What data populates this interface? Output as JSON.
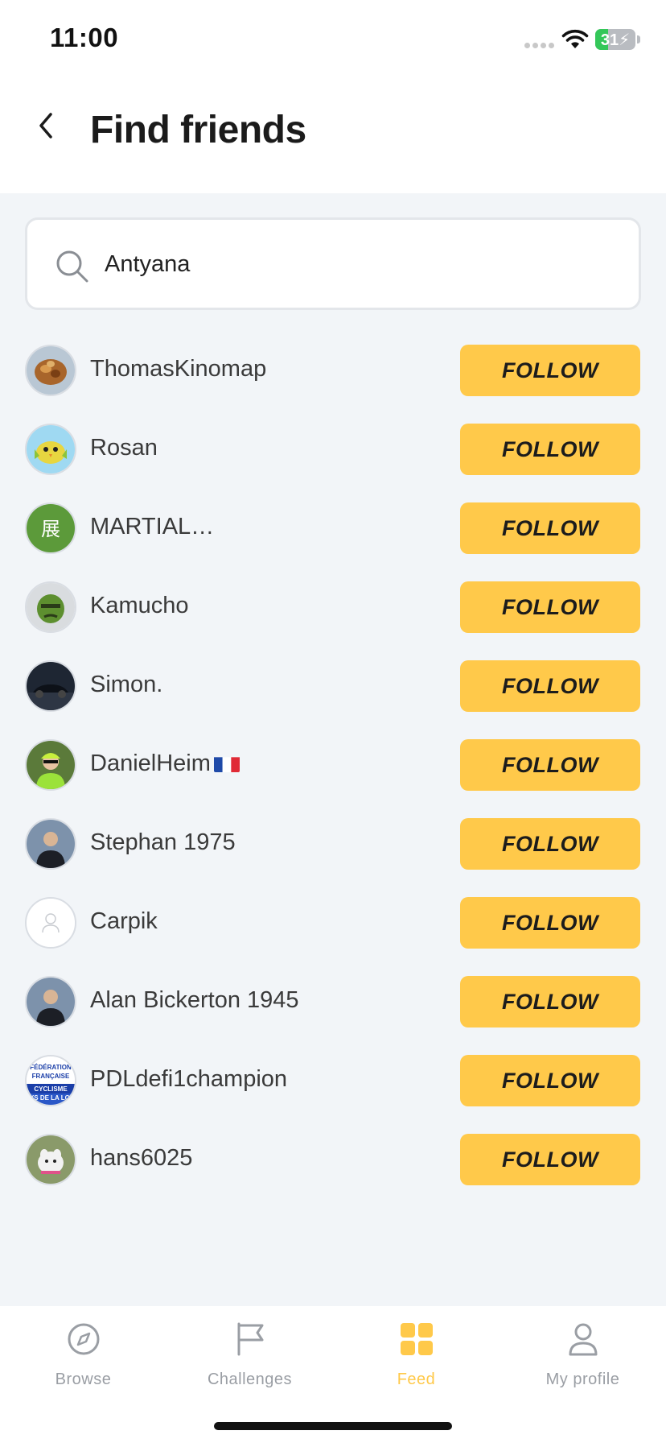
{
  "status_bar": {
    "time": "11:00",
    "battery": "31",
    "battery_level": 0.31,
    "battery_charging": true
  },
  "header": {
    "title": "Find friends",
    "back_icon": "chevron-left-icon"
  },
  "search": {
    "icon": "search-icon",
    "value": "Antyana",
    "placeholder": ""
  },
  "users": [
    {
      "username": "ThomasKinomap",
      "avatar": "food-photo",
      "follow_label": "FOLLOW"
    },
    {
      "username": "Rosan",
      "avatar": "bird-illustration",
      "follow_label": "FOLLOW"
    },
    {
      "username": "MARTIAL…",
      "avatar": "initial-展",
      "avatar_text": "展",
      "avatar_color": "#5c9a3a",
      "follow_label": "FOLLOW"
    },
    {
      "username": "Kamucho",
      "avatar": "green-character",
      "follow_label": "FOLLOW"
    },
    {
      "username": "Simon.",
      "avatar": "car-photo",
      "follow_label": "FOLLOW"
    },
    {
      "username": "DanielHeim",
      "flag": "france-flag",
      "avatar": "cyclist-photo",
      "follow_label": "FOLLOW"
    },
    {
      "username": "Stephan 1975",
      "avatar": "person-photo",
      "follow_label": "FOLLOW"
    },
    {
      "username": "Carpik",
      "avatar": "default-avatar",
      "follow_label": "FOLLOW"
    },
    {
      "username": "Alan Bickerton 1945",
      "avatar": "person-photo",
      "follow_label": "FOLLOW"
    },
    {
      "username": "PDLdefi1champion",
      "avatar": "federation-logo",
      "avatar_text_lines": [
        "FÉDÉRATION",
        "FRANÇAISE",
        "CYCLISME",
        "YS DE LA LOI"
      ],
      "follow_label": "FOLLOW"
    },
    {
      "username": "hans6025",
      "avatar": "dog-photo",
      "follow_label": "FOLLOW"
    }
  ],
  "tabs": [
    {
      "label": "Browse",
      "icon": "compass-icon",
      "active": false
    },
    {
      "label": "Challenges",
      "icon": "flag-icon",
      "active": false
    },
    {
      "label": "Feed",
      "icon": "grid-icon",
      "active": true
    },
    {
      "label": "My profile",
      "icon": "person-icon",
      "active": false
    }
  ],
  "colors": {
    "accent": "#ffc94a",
    "background": "#f2f5f8",
    "tab_inactive": "#9a9ea4"
  }
}
